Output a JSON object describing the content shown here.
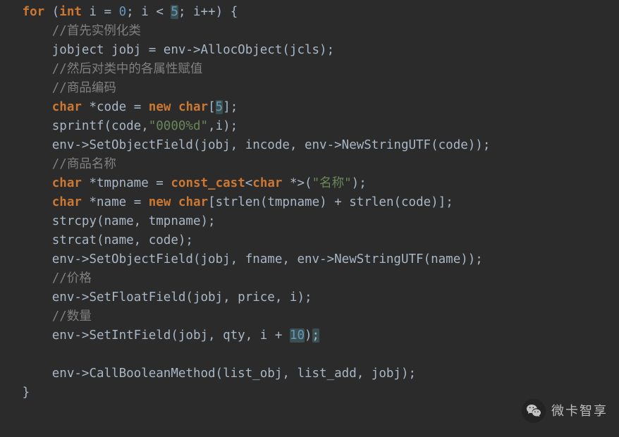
{
  "code": {
    "line1": {
      "kw1": "for",
      "kw2": "int",
      "id": "i",
      "num0": "0",
      "op": "<",
      "num5": "5",
      "rest": "; i++) {"
    },
    "line2": {
      "cmt": "//首先实例化类"
    },
    "line3": {
      "txt": "jobject jobj = env->AllocObject(jcls);"
    },
    "line4": {
      "cmt": "//然后对类中的各属性赋值"
    },
    "line5": {
      "cmt": "//商品编码"
    },
    "line6": {
      "kw1": "char",
      "id": "*code",
      "op": "=",
      "kw2": "new",
      "kw3": "char",
      "num": "5"
    },
    "line7": {
      "pre": "sprintf(code,",
      "str": "\"0000%d\"",
      "post": ",i);"
    },
    "line8": {
      "txt": "env->SetObjectField(jobj, incode, env->NewStringUTF(code));"
    },
    "line9": {
      "cmt": "//商品名称"
    },
    "line10": {
      "kw1": "char",
      "id": "*tmpname",
      "kw2": "const_cast",
      "kw3": "char",
      "rest": " *>(",
      "str": "\"名称\"",
      "post": ");"
    },
    "line11": {
      "kw1": "char",
      "id": "*name",
      "kw2": "new",
      "kw3": "char",
      "rest": "[strlen(tmpname) + strlen(code)];"
    },
    "line12": {
      "txt": "strcpy(name, tmpname);"
    },
    "line13": {
      "txt": "strcat(name, code);"
    },
    "line14": {
      "txt": "env->SetObjectField(jobj, fname, env->NewStringUTF(name));"
    },
    "line15": {
      "cmt": "//价格"
    },
    "line16": {
      "txt": "env->SetFloatField(jobj, price, i);"
    },
    "line17": {
      "cmt": "//数量"
    },
    "line18": {
      "pre": "env->SetIntField(jobj, qty, i + ",
      "num": "10",
      "post": ")",
      "semi": ";"
    },
    "line19": {
      "blank": ""
    },
    "line20": {
      "txt": "env->CallBooleanMethod(list_obj, list_add, jobj);"
    },
    "line21": {
      "brace": "}"
    }
  },
  "watermark": {
    "text": "微卡智享"
  }
}
